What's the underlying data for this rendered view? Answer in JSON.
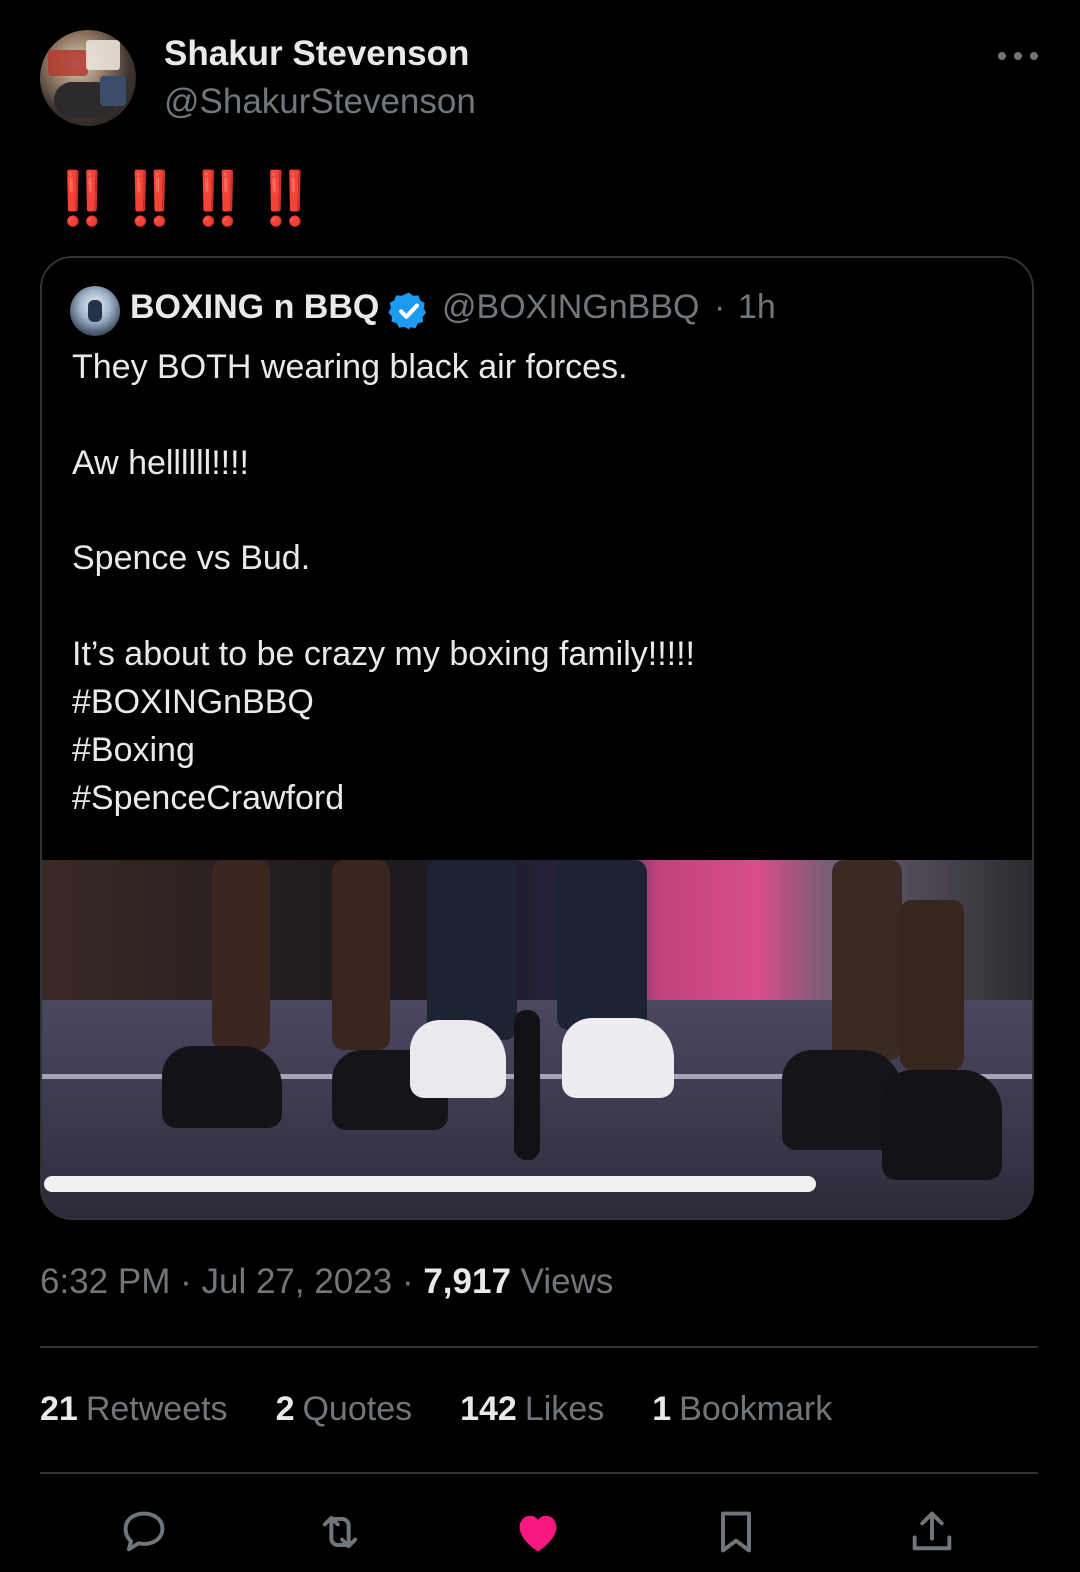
{
  "author": {
    "name": "Shakur Stevenson",
    "handle": "@ShakurStevenson"
  },
  "tweet": {
    "text": "‼️‼️‼️‼️"
  },
  "quoted": {
    "name": "BOXING n BBQ",
    "handle": "@BOXINGnBBQ",
    "separator": "·",
    "time": "1h",
    "lines": [
      "They BOTH wearing black air forces.",
      "Aw hellllll!!!!",
      "Spence vs Bud.",
      "It’s about to be crazy my boxing family!!!!!",
      "#BOXINGnBBQ",
      "#Boxing",
      "#SpenceCrawford"
    ],
    "video_progress": 0.78
  },
  "meta": {
    "time": "6:32 PM",
    "date": "Jul 27, 2023",
    "views_count": "7,917",
    "views_label": "Views",
    "sep": "·"
  },
  "stats": {
    "retweets": {
      "count": "21",
      "label": "Retweets"
    },
    "quotes": {
      "count": "2",
      "label": "Quotes"
    },
    "likes": {
      "count": "142",
      "label": "Likes"
    },
    "bookmarks": {
      "count": "1",
      "label": "Bookmark"
    }
  },
  "actions": [
    "reply-icon",
    "retweet-icon",
    "like-icon",
    "bookmark-icon",
    "share-icon"
  ],
  "colors": {
    "background": "#000000",
    "text": "#e7e9ea",
    "secondary": "#71767b",
    "border": "#2f3336",
    "verified": "#1d9bf0",
    "like": "#f91880",
    "exclamation": "#d8232a"
  }
}
